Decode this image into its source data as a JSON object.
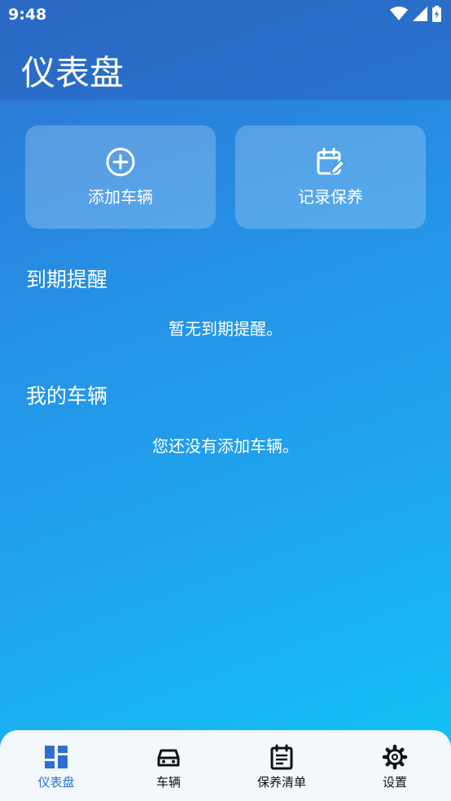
{
  "status": {
    "time": "9:48"
  },
  "header": {
    "title": "仪表盘"
  },
  "actions": [
    {
      "label": "添加车辆",
      "icon": "add-circle-icon"
    },
    {
      "label": "记录保养",
      "icon": "calendar-edit-icon"
    }
  ],
  "reminders": {
    "title": "到期提醒",
    "empty": "暂无到期提醒。"
  },
  "vehicles": {
    "title": "我的车辆",
    "empty": "您还没有添加车辆。"
  },
  "nav": [
    {
      "label": "仪表盘",
      "icon": "dashboard-icon",
      "active": true
    },
    {
      "label": "车辆",
      "icon": "car-icon"
    },
    {
      "label": "保养清单",
      "icon": "checklist-icon"
    },
    {
      "label": "设置",
      "icon": "gear-icon"
    }
  ],
  "colors": {
    "accent": "#2f6fcf",
    "nav_bg": "#f3f8fc"
  }
}
